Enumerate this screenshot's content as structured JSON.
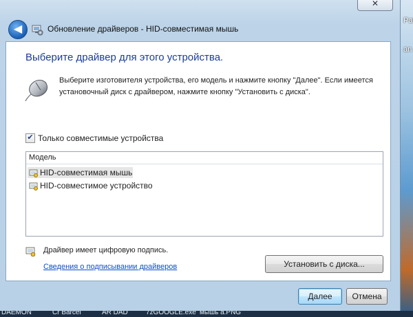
{
  "window": {
    "title": "Обновление драйверов - HID-совместимая мышь",
    "close_label": "✕",
    "back_label": "◀"
  },
  "content": {
    "heading": "Выберите драйвер для этого устройства.",
    "description": "Выберите изготовителя устройства, его модель и нажмите кнопку \"Далее\". Если имеется установочный диск с  драйвером, нажмите кнопку \"Установить с диска\".",
    "compatible_checkbox": {
      "label": "Только совместимые устройства",
      "checked": true,
      "mark": "✔"
    },
    "model_list": {
      "header": "Модель",
      "items": [
        {
          "label": "HID-совместимая мышь",
          "selected": true
        },
        {
          "label": "HID-совместимое устройство",
          "selected": false
        }
      ]
    },
    "signature_text": "Драйвер имеет цифровую подпись.",
    "signature_link": "Сведения о подписывании драйверов",
    "install_from_disk_button": "Установить с диска..."
  },
  "footer": {
    "next_button": "Далее",
    "cancel_button": "Отмена"
  },
  "desktop": {
    "right_labels": [
      "Pat",
      "an"
    ],
    "taskbar_items": [
      "DAEMON",
      "Cr Barcel",
      "AR DAD",
      "7zGOOGLE.exe",
      "мышь a.PNG"
    ]
  },
  "icons": {
    "back": "back-arrow-icon",
    "device": "device-manager-icon",
    "mouse": "mouse-icon",
    "driver": "driver-package-icon",
    "signature": "signed-driver-icon"
  },
  "colors": {
    "heading": "#1a3e96",
    "link": "#0a4fc7",
    "selection": "#e6e6e6",
    "default_button": "#bee6fd"
  }
}
